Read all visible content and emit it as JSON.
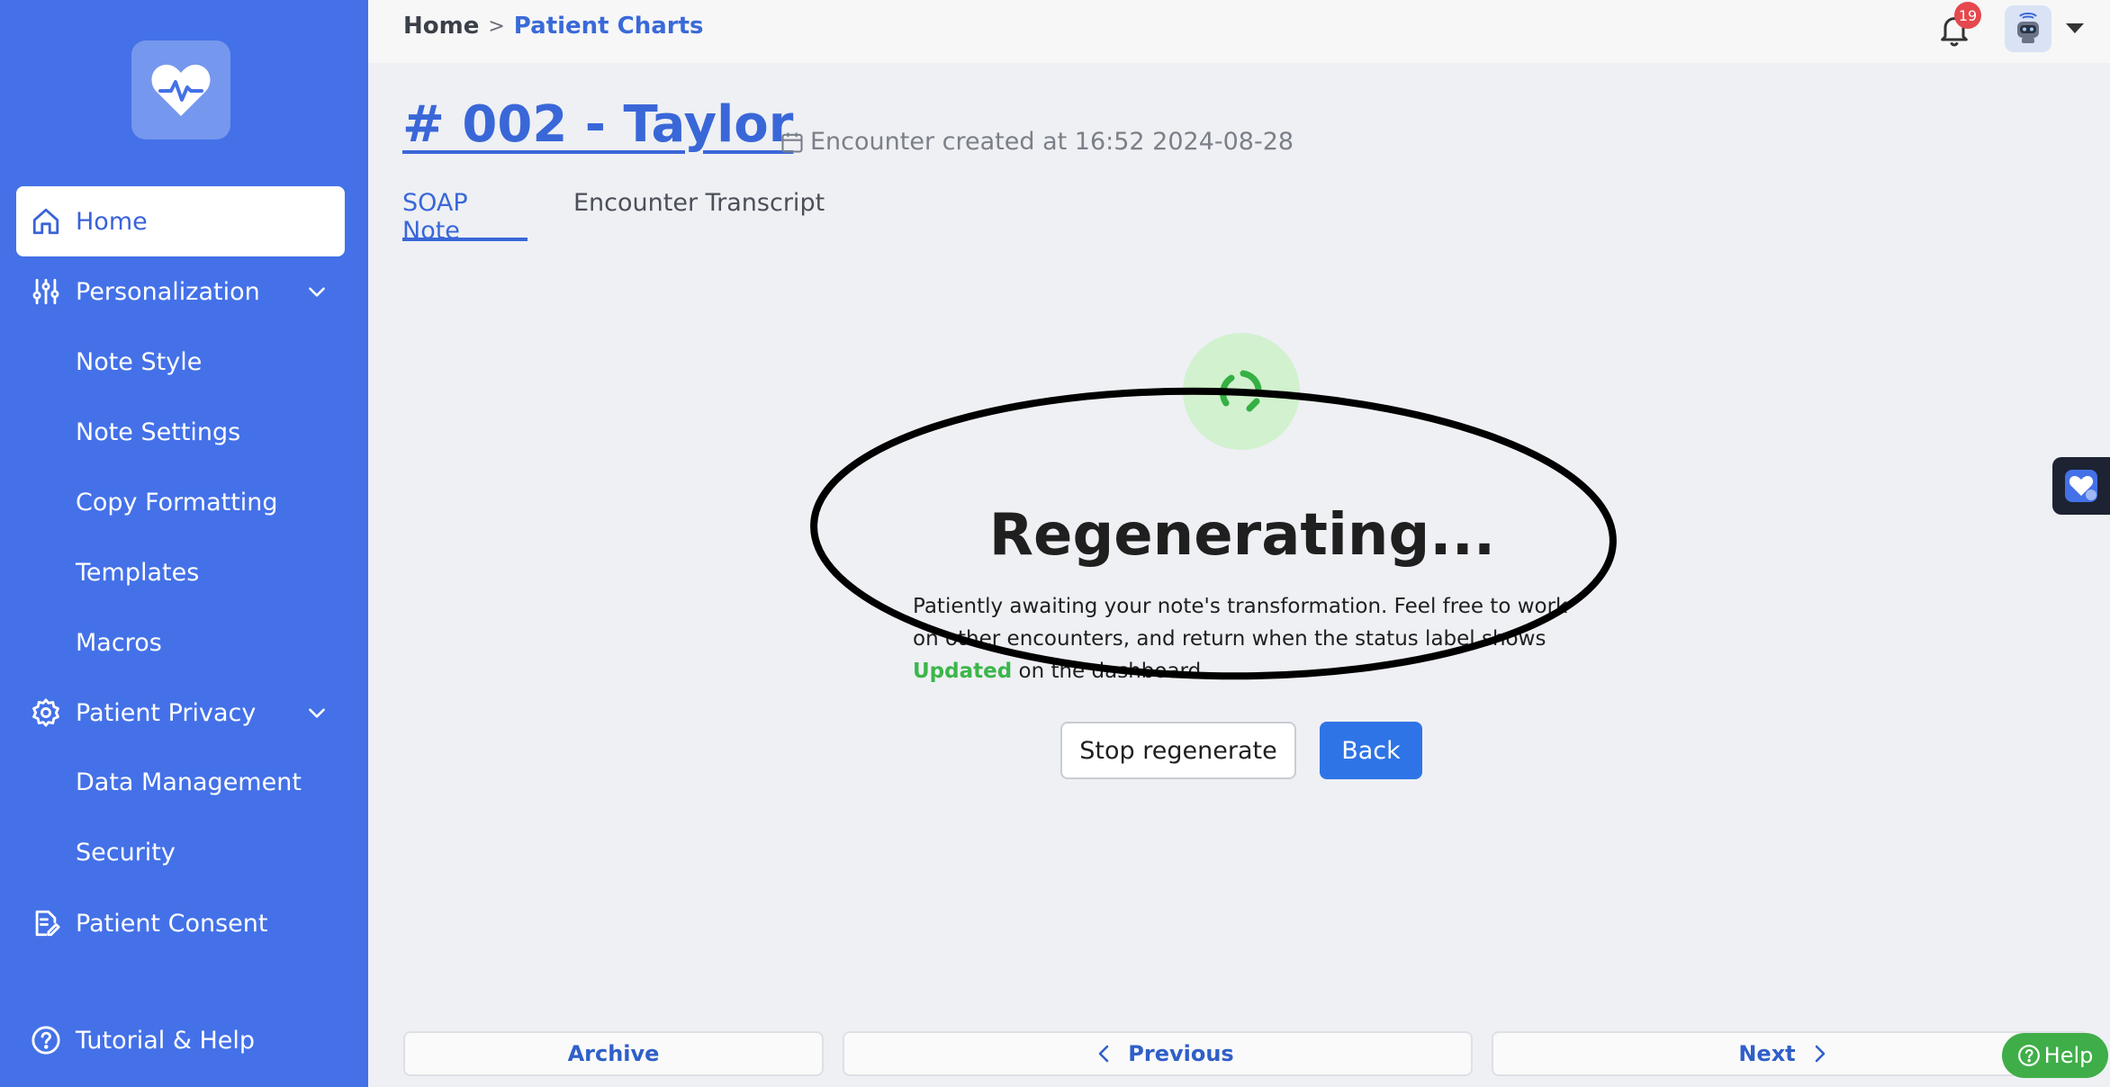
{
  "sidebar": {
    "nav": [
      {
        "label": "Home",
        "icon": "home-icon",
        "active": true
      },
      {
        "label": "Personalization",
        "icon": "sliders-icon",
        "expandable": true
      },
      {
        "label": "Patient Privacy",
        "icon": "gear-icon",
        "expandable": true
      },
      {
        "label": "Patient Consent",
        "icon": "document-edit-icon"
      },
      {
        "label": "Tutorial & Help",
        "icon": "question-circle-icon"
      }
    ],
    "personalization_items": [
      "Note Style",
      "Note Settings",
      "Copy Formatting",
      "Templates",
      "Macros"
    ],
    "privacy_items": [
      "Data Management",
      "Security"
    ]
  },
  "topbar": {
    "breadcrumb": {
      "home": "Home",
      "separator": ">",
      "current": "Patient Charts"
    },
    "notification_count": "19"
  },
  "header": {
    "title": "# 002 - Taylor",
    "encounter_created": "Encounter created at 16:52 2024-08-28"
  },
  "tabs": [
    {
      "label": "SOAP Note",
      "active": true
    },
    {
      "label": "Encounter Transcript",
      "active": false
    }
  ],
  "status": {
    "title": "Regenerating...",
    "desc_before": "Patiently awaiting your note's transformation. Feel free to work on other encounters, and return when the status label shows ",
    "desc_highlight": "Updated",
    "desc_after": " on the dashboard."
  },
  "actions": {
    "stop": "Stop regenerate",
    "back": "Back"
  },
  "footer": {
    "archive": "Archive",
    "previous": "Previous",
    "next": "Next",
    "help": "Help"
  },
  "colors": {
    "sidebar_bg": "#4471e8",
    "accent": "#3a67d8",
    "primary_button": "#2f74e6",
    "success": "#3cb64a",
    "badge": "#e5484d"
  }
}
